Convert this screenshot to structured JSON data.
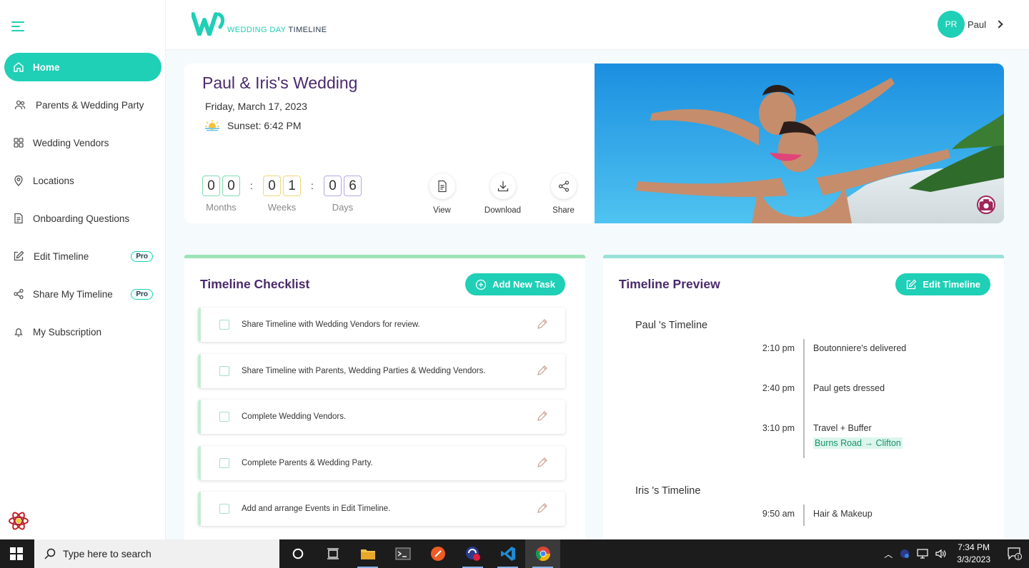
{
  "app": {
    "logo_brand": "WEDDING DAY",
    "logo_suffix": "TIMELINE"
  },
  "user": {
    "initials": "PR",
    "name": "Paul"
  },
  "sidebar": {
    "items": [
      {
        "label": "Home",
        "icon": "home-icon",
        "active": true
      },
      {
        "label": "Parents & Wedding Party",
        "icon": "users-icon"
      },
      {
        "label": "Wedding Vendors",
        "icon": "grid-icon"
      },
      {
        "label": "Locations",
        "icon": "map-pin-icon"
      },
      {
        "label": "Onboarding Questions",
        "icon": "document-icon"
      },
      {
        "label": "Edit Timeline",
        "icon": "edit-icon",
        "badge": "Pro"
      },
      {
        "label": "Share My Timeline",
        "icon": "share-icon",
        "badge": "Pro"
      },
      {
        "label": "My Subscription",
        "icon": "bell-icon"
      }
    ]
  },
  "hero": {
    "title": "Paul & Iris's Wedding",
    "date": "Friday, March 17, 2023",
    "sunset": "Sunset: 6:42 PM",
    "countdown": {
      "months": [
        "0",
        "0"
      ],
      "weeks": [
        "0",
        "1"
      ],
      "days": [
        "0",
        "6"
      ],
      "months_label": "Months",
      "weeks_label": "Weeks",
      "days_label": "Days",
      "separator": ":"
    },
    "actions": {
      "view": "View",
      "download": "Download",
      "share": "Share"
    }
  },
  "checklist": {
    "title": "Timeline Checklist",
    "add_button": "Add New Task",
    "tasks": [
      "Share Timeline with Wedding Vendors for review.",
      "Share Timeline with Parents, Wedding Parties & Wedding Vendors.",
      "Complete Wedding Vendors.",
      "Complete Parents & Wedding Party.",
      "Add and arrange Events in Edit Timeline."
    ]
  },
  "preview": {
    "title": "Timeline Preview",
    "edit_button": "Edit Timeline",
    "timelines": [
      {
        "heading": "Paul 's Timeline",
        "events": [
          {
            "time": "2:10 pm",
            "event": "Boutonniere's delivered"
          },
          {
            "time": "2:40 pm",
            "event": "Paul gets dressed"
          },
          {
            "time": "3:10 pm",
            "event": "Travel + Buffer",
            "sub": "Burns Road → Clifton"
          }
        ]
      },
      {
        "heading": "Iris 's Timeline",
        "events": [
          {
            "time": "9:50 am",
            "event": "Hair & Makeup"
          }
        ]
      }
    ]
  },
  "taskbar": {
    "search_placeholder": "Type here to search",
    "time": "7:34 PM",
    "date": "3/3/2023",
    "notification_count": "1"
  },
  "colors": {
    "accent": "#1fcfb6",
    "title": "#4a2a6a"
  }
}
